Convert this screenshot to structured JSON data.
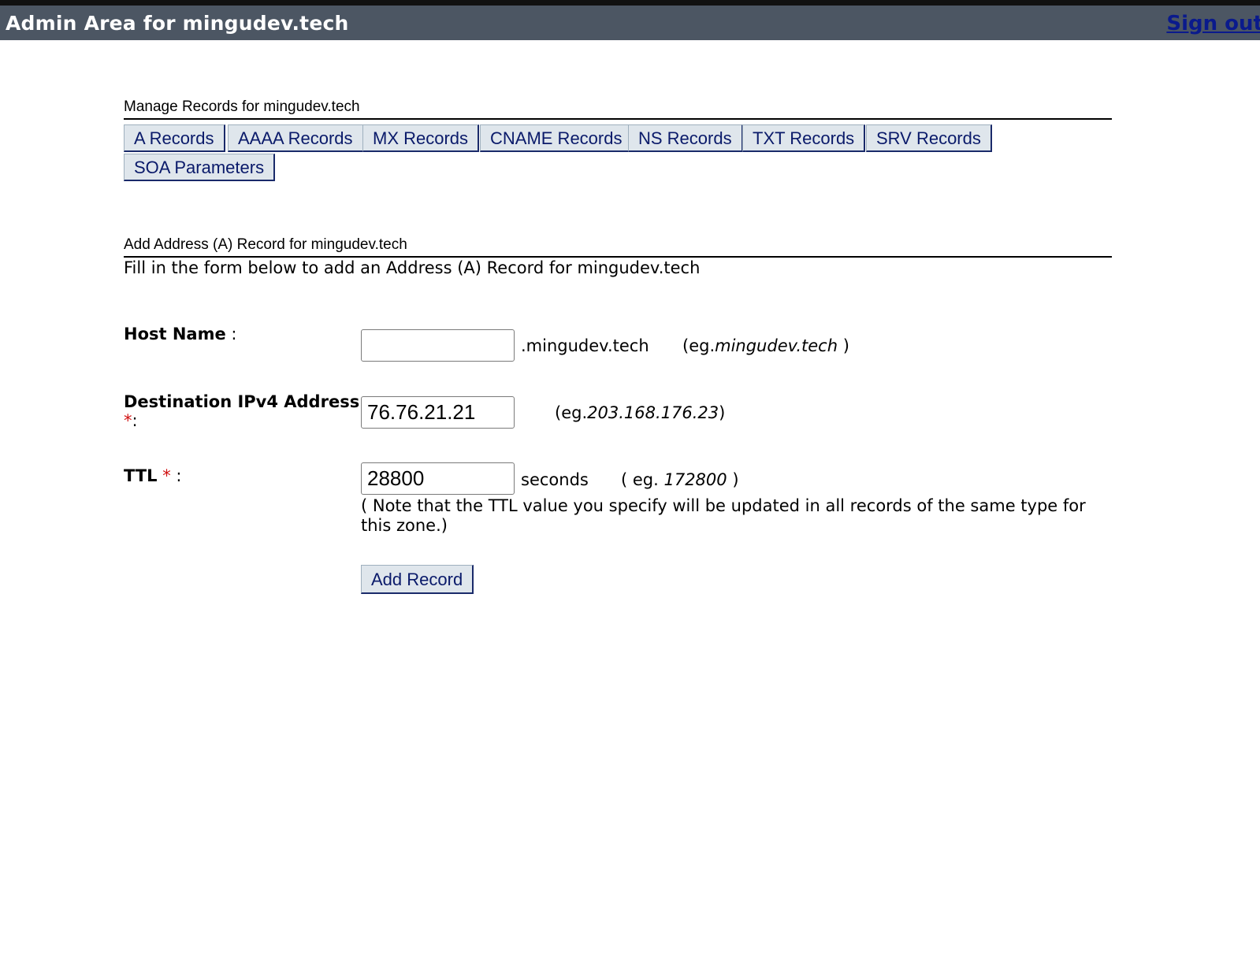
{
  "header": {
    "title": "Admin Area for mingudev.tech",
    "signout_label": "Sign out"
  },
  "manage": {
    "heading": "Manage Records for mingudev.tech",
    "tabs": [
      {
        "label": "A Records"
      },
      {
        "label": "AAAA Records"
      },
      {
        "label": "MX Records"
      },
      {
        "label": "CNAME Records"
      },
      {
        "label": "NS Records"
      },
      {
        "label": "TXT Records"
      },
      {
        "label": "SRV Records"
      },
      {
        "label": "SOA Parameters"
      }
    ]
  },
  "form": {
    "heading": "Add Address (A) Record for mingudev.tech",
    "description": "Fill in the form below to add an Address (A) Record for mingudev.tech",
    "host": {
      "label": "Host Name",
      "separator": " :",
      "value": "",
      "suffix": ".mingudev.tech",
      "example_prefix": "(eg.",
      "example_value": "mingudev.tech",
      "example_suffix": " )"
    },
    "destination": {
      "label": "Destination IPv4 Address",
      "required_mark": "*",
      "separator": ":",
      "value": "76.76.21.21",
      "example_prefix": "(eg.",
      "example_value": "203.168.176.23",
      "example_suffix": ")"
    },
    "ttl": {
      "label": "TTL",
      "required_mark": "*",
      "separator": " :",
      "value": "28800",
      "unit": "seconds",
      "example_prefix": "( eg. ",
      "example_value": "172800",
      "example_suffix": " )",
      "note": "( Note that the TTL value you specify will be updated in all records of the same type for this zone.)"
    },
    "submit_label": "Add Record"
  },
  "colors": {
    "header_bg": "#4c5663",
    "button_bg": "#dfe6ec",
    "link": "#0a1a8c",
    "required": "#d01010"
  }
}
